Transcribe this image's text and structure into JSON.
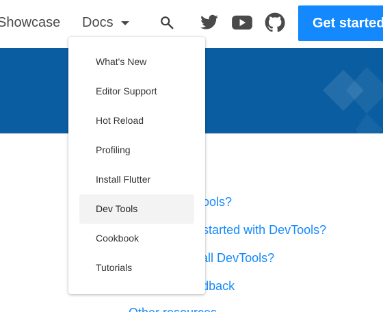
{
  "nav": {
    "showcase_label": "Showcase",
    "docs_label": "Docs",
    "cta_label": "Get started"
  },
  "icons": {
    "search": "search-icon",
    "twitter": "twitter-icon",
    "youtube": "youtube-icon",
    "github": "github-icon",
    "docs_caret": "caret-down-icon"
  },
  "dropdown": {
    "items": [
      {
        "label": "What's New"
      },
      {
        "label": "Editor Support"
      },
      {
        "label": "Hot Reload"
      },
      {
        "label": "Profiling"
      },
      {
        "label": "Install Flutter"
      },
      {
        "label": "Dev Tools",
        "active": true
      },
      {
        "label": "Cookbook"
      },
      {
        "label": "Tutorials"
      }
    ]
  },
  "content": {
    "links": [
      "What is DevTools?",
      "How do I get started with DevTools?",
      "How do I install DevTools?",
      "Providing feedback",
      "Other resources"
    ]
  },
  "colors": {
    "accent": "#1389fd",
    "banner": "#0a5da1",
    "nav_text": "#4a4a4a",
    "active_item_bg": "#f3f3f3"
  }
}
